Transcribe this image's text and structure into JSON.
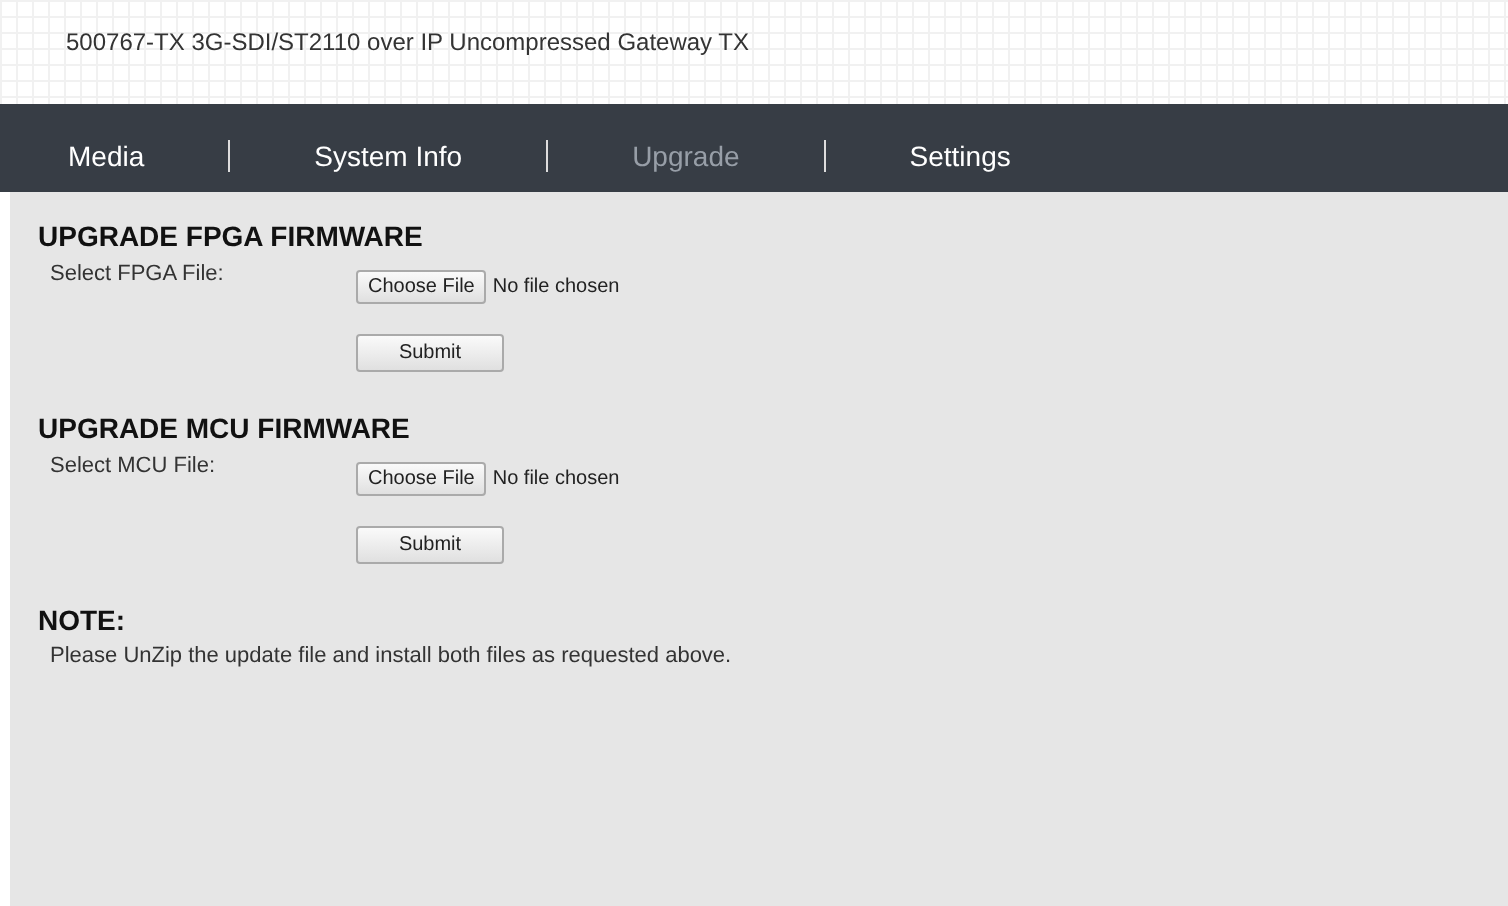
{
  "header": {
    "title": "500767-TX 3G-SDI/ST2110 over IP Uncompressed Gateway TX"
  },
  "tabs": [
    {
      "label": "Media",
      "selected": false
    },
    {
      "label": "System Info",
      "selected": false
    },
    {
      "label": "Upgrade",
      "selected": true
    },
    {
      "label": "Settings",
      "selected": false
    }
  ],
  "sections": [
    {
      "heading": "UPGRADE FPGA FIRMWARE",
      "label": "Select FPGA File:",
      "choose_button": "Choose File",
      "file_status": "No file chosen",
      "submit": "Submit"
    },
    {
      "heading": "UPGRADE MCU FIRMWARE",
      "label": "Select MCU File:",
      "choose_button": "Choose File",
      "file_status": "No file chosen",
      "submit": "Submit"
    }
  ],
  "note": {
    "heading": "NOTE:",
    "text": "Please UnZip the update file and install both files as requested above."
  }
}
